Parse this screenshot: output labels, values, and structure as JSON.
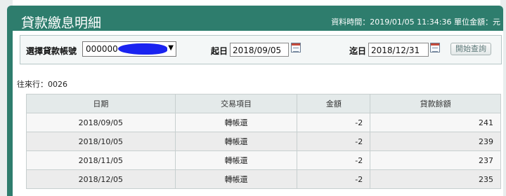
{
  "header": {
    "title": "貸款繳息明細",
    "meta": "資料時間：2019/01/05 11:34:36 單位金額：元"
  },
  "filter": {
    "account_label": "選擇貸款帳號",
    "account_value": "000000",
    "start_label": "起日",
    "start_value": "2018/09/05",
    "end_label": "迄日",
    "end_value": "2018/12/31",
    "query_button": "開始查詢"
  },
  "bank_info": "往來行：0026",
  "table": {
    "headers": [
      "日期",
      "交易項目",
      "金額",
      "貸款餘額"
    ],
    "rows": [
      [
        "2018/09/05",
        "轉帳還",
        "-2",
        "241"
      ],
      [
        "2018/10/05",
        "轉帳還",
        "-2",
        "239"
      ],
      [
        "2018/11/05",
        "轉帳還",
        "-2",
        "237"
      ],
      [
        "2018/12/05",
        "轉帳還",
        "-2",
        "235"
      ]
    ]
  },
  "colors": {
    "header_bg": "#2e7d6d",
    "redaction": "#1a23f0",
    "table_header_bg": "#e4eaea"
  }
}
